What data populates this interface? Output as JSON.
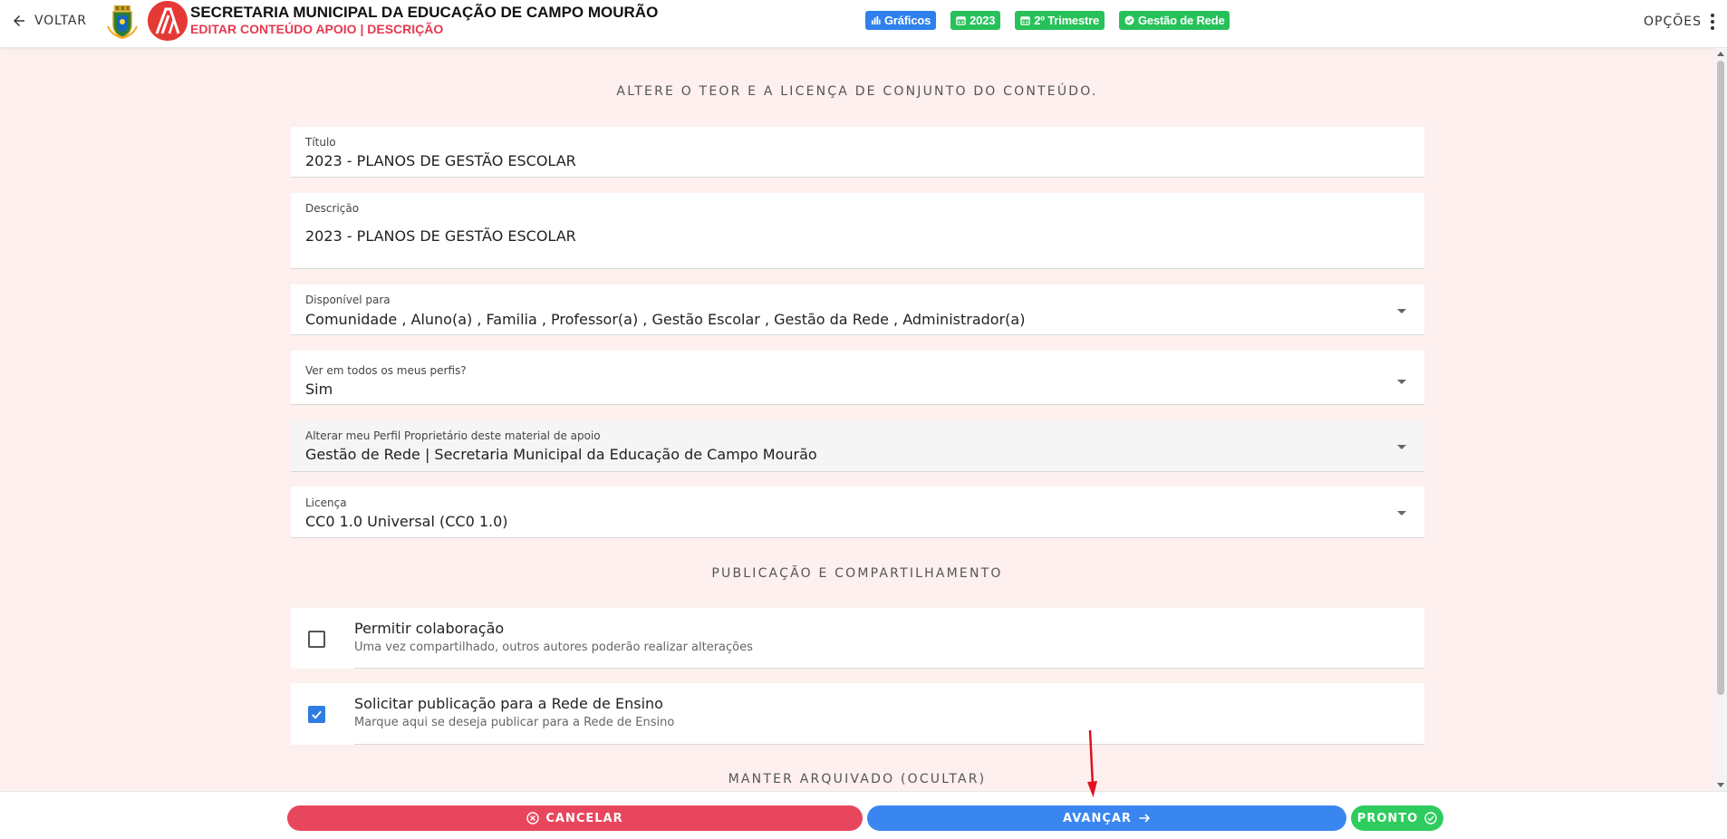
{
  "header": {
    "back_label": "VOLTAR",
    "title": "SECRETARIA MUNICIPAL DA EDUCAÇÃO DE CAMPO MOURÃO",
    "subtitle": "EDITAR CONTEÚDO APOIO | DESCRIÇÃO",
    "options_label": "OPÇÕES",
    "chips": [
      {
        "label": "Gráficos",
        "icon": "bar-chart-icon",
        "color": "#2f80ed"
      },
      {
        "label": "2023",
        "icon": "calendar-icon",
        "color": "#27c15a"
      },
      {
        "label": "2º Trimestre",
        "icon": "calendar-icon",
        "color": "#27c15a"
      },
      {
        "label": "Gestão de Rede",
        "icon": "check-circle-icon",
        "color": "#27c15a"
      }
    ]
  },
  "main": {
    "section_title": "ALTERE O TEOR E A LICENÇA DE CONJUNTO DO CONTEÚDO.",
    "fields": {
      "titulo": {
        "label": "Título",
        "value": "2023 - PLANOS DE GESTÃO ESCOLAR"
      },
      "descricao": {
        "label": "Descrição",
        "value": "2023 - PLANOS DE GESTÃO ESCOLAR"
      },
      "disponivel": {
        "label": "Disponível para",
        "value": "Comunidade , Aluno(a) , Familia , Professor(a) , Gestão Escolar , Gestão da Rede , Administrador(a)"
      },
      "ver_perfis": {
        "label": "Ver em todos os meus perfis?",
        "value": "Sim"
      },
      "perfil_proprietario": {
        "label": "Alterar meu Perfil Proprietário deste material de apoio",
        "value": "Gestão de Rede | Secretaria Municipal da Educação de Campo Mourão"
      },
      "licenca": {
        "label": "Licença",
        "value": "CC0 1.0 Universal (CC0 1.0)"
      }
    },
    "publication_title": "PUBLICAÇÃO E COMPARTILHAMENTO",
    "options": [
      {
        "title": "Permitir colaboração",
        "subtitle": "Uma vez compartilhado, outros autores poderão realizar alterações",
        "checked": false
      },
      {
        "title": "Solicitar publicação para a Rede de Ensino",
        "subtitle": "Marque aqui se deseja publicar para a Rede de Ensino",
        "checked": true
      }
    ],
    "archive_title": "MANTER ARQUIVADO (OCULTAR)"
  },
  "footer": {
    "cancel_label": "CANCELAR",
    "next_label": "AVANÇAR",
    "done_label": "PRONTO"
  },
  "colors": {
    "accent_red": "#e8465d",
    "accent_blue": "#3a86f0",
    "accent_green": "#2ecc5e",
    "background": "#fdf0ef"
  }
}
